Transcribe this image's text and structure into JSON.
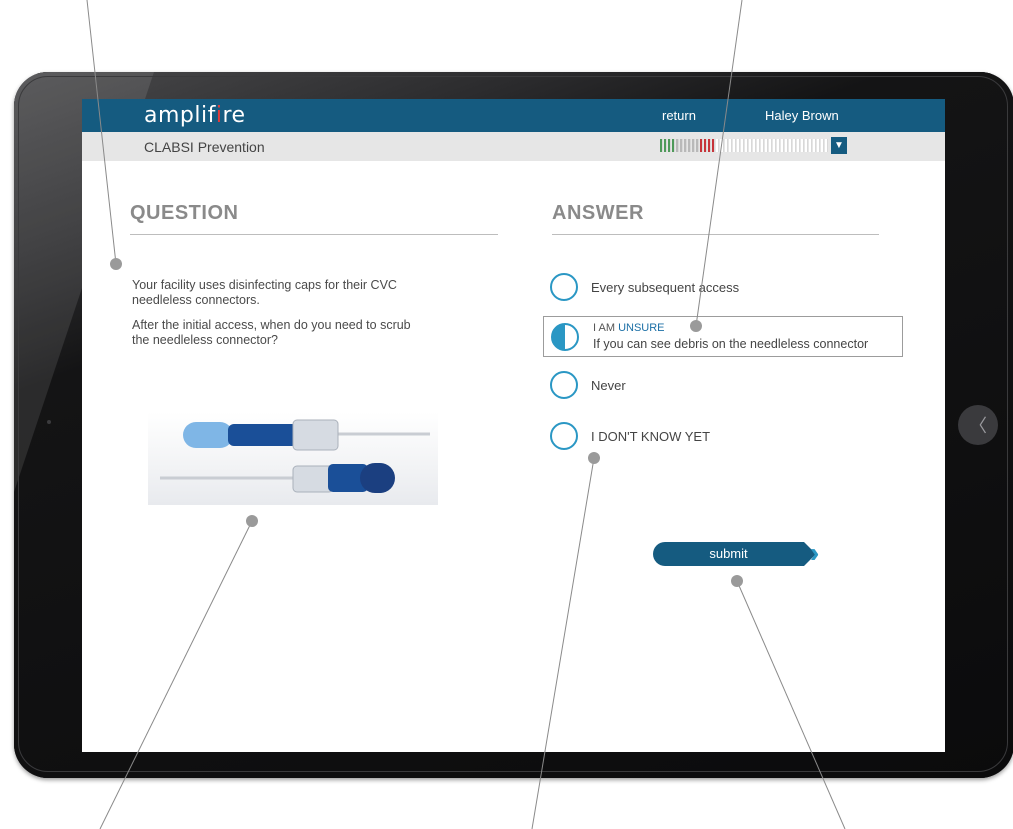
{
  "app": {
    "logo": {
      "before": "amplif",
      "highlight": "i",
      "after": "re"
    },
    "header": {
      "return_label": "return",
      "user_name": "Haley Brown"
    },
    "module_title": "CLABSI Prevention",
    "progress": {
      "segments_total": 42,
      "green_done": 4,
      "gray_done": 6,
      "red_done": 4
    }
  },
  "question": {
    "heading": "QUESTION",
    "line1": "Your facility uses disinfecting caps for their CVC",
    "line2": "needleless connectors.",
    "line3": "After the initial access, when do you need to scrub",
    "line4": "the needleless connector?"
  },
  "answer": {
    "heading": "ANSWER",
    "options": [
      {
        "label": "Every subsequent access"
      },
      {
        "label": "If you can see debris on the needleless connector",
        "confidence_prefix": "I AM ",
        "confidence_word": "UNSURE"
      },
      {
        "label": "Never"
      },
      {
        "label": "I DON'T KNOW YET"
      }
    ],
    "submit_label": "submit"
  },
  "colors": {
    "brand": "#155b80",
    "accent": "#2a97c4",
    "alert": "#e23a3a",
    "progress_green": "#4f9a5a",
    "progress_red": "#c7343a"
  },
  "icons": {
    "home_button": "back-arrow-icon",
    "dropdown": "triangle-down-icon",
    "submit_chevron": "chevron-right-icon"
  }
}
